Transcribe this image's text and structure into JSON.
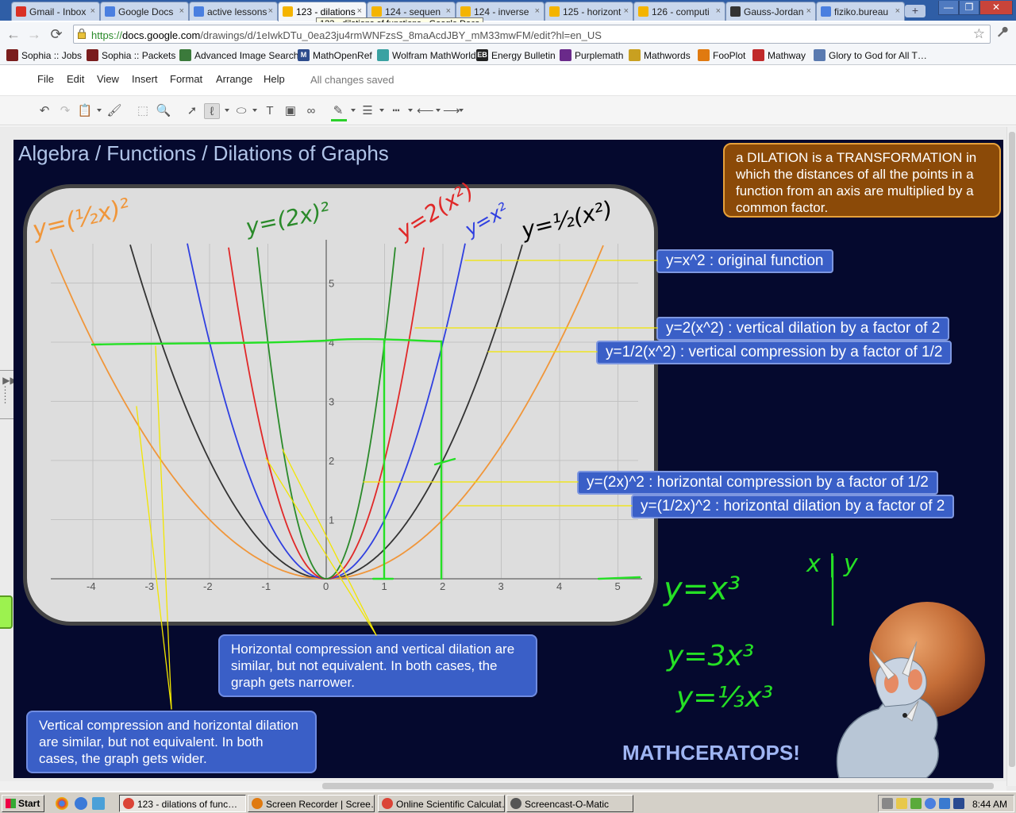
{
  "browser": {
    "tabs": [
      {
        "label": "Gmail - Inbox",
        "fav": "#d93025"
      },
      {
        "label": "Google Docs",
        "fav": "#4a7fe0"
      },
      {
        "label": "active lessons",
        "fav": "#4a7fe0"
      },
      {
        "label": "123 - dilations",
        "fav": "#f4b400",
        "active": true
      },
      {
        "label": "124 - sequen",
        "fav": "#f4b400"
      },
      {
        "label": "124 - inverse",
        "fav": "#f4b400"
      },
      {
        "label": "125 - horizont",
        "fav": "#f4b400"
      },
      {
        "label": "126 - computi",
        "fav": "#f4b400"
      },
      {
        "label": "Gauss-Jordan",
        "fav": "#333"
      },
      {
        "label": "fiziko.bureau",
        "fav": "#4a7fe0"
      }
    ],
    "tab_close": "×",
    "new_tab": "+",
    "window_controls": [
      "—",
      "❐",
      "✕"
    ],
    "tooltip": "123 - dilations of functions - Google Docs",
    "url": {
      "scheme": "https://",
      "host": "docs.google.com",
      "path": "/drawings/d/1eIwkDTu_0ea23ju4rmWNFzsS_8maAcdJBY_mM33mwFM/edit?hl=en_US"
    },
    "back": "←",
    "forward": "→",
    "reload": "⟳",
    "star": "☆",
    "wrench": "🔧",
    "bookmarks": [
      {
        "label": "Sophia :: Jobs",
        "fav": "#7a1d1d",
        "glyph": ""
      },
      {
        "label": "Sophia :: Packets",
        "fav": "#7a1d1d",
        "glyph": ""
      },
      {
        "label": "Advanced Image Search",
        "fav": "#3b7a3b",
        "glyph": ""
      },
      {
        "label": "MathOpenRef",
        "fav": "#2d4c8c",
        "glyph": "M"
      },
      {
        "label": "Wolfram MathWorld",
        "fav": "#3aa2a2",
        "glyph": ""
      },
      {
        "label": "Energy Bulletin",
        "fav": "#222",
        "glyph": "EB"
      },
      {
        "label": "Purplemath",
        "fav": "#6a2a8a",
        "glyph": ""
      },
      {
        "label": "Mathwords",
        "fav": "#c9a020",
        "glyph": ""
      },
      {
        "label": "FooPlot",
        "fav": "#e07a10",
        "glyph": ""
      },
      {
        "label": "Mathway",
        "fav": "#c02a2a",
        "glyph": ""
      },
      {
        "label": "Glory to God for All T…",
        "fav": "#5a7ab0",
        "glyph": ""
      }
    ]
  },
  "docs": {
    "menu": [
      "File",
      "Edit",
      "View",
      "Insert",
      "Format",
      "Arrange",
      "Help"
    ],
    "save_status": "All changes saved",
    "toolbar_icons": [
      "undo-icon",
      "redo-icon",
      "paste-icon",
      "paint-format-icon",
      "zoom-fit-icon",
      "zoom-icon",
      "select-icon",
      "line-tool-icon",
      "shape-icon",
      "textbox-icon",
      "image-icon",
      "link-icon",
      "line-color-icon",
      "line-weight-icon",
      "line-dash-icon",
      "line-start-icon",
      "line-end-icon"
    ]
  },
  "slide": {
    "title": "Algebra / Functions / Dilations of Graphs",
    "definition": "a DILATION is a TRANSFORMATION in which the distances of all the points in a function from an axis are multiplied by a common factor.",
    "callouts": [
      "y=x^2 : original function",
      "y=2(x^2) : vertical dilation by a factor of 2",
      "y=1/2(x^2) : vertical compression by a factor of 1/2",
      "y=(2x)^2 : horizontal compression by a factor of 1/2",
      "y=(1/2x)^2 : horizontal dilation by a factor of 2"
    ],
    "note_narrower": "Horizontal compression and vertical dilation are similar, but not equivalent. In both cases, the graph gets narrower.",
    "note_wider": "Vertical compression and horizontal dilation are similar, but not equivalent. In both cases, the graph gets wider.",
    "brand": "MATHCERATOPS!",
    "graph": {
      "x_ticks": [
        "-4",
        "-3",
        "-2",
        "-1",
        "0",
        "1",
        "2",
        "3",
        "4",
        "5"
      ],
      "y_ticks": [
        "1",
        "2",
        "3",
        "4",
        "5"
      ],
      "curve_colors": {
        "original": "#2f3fe0",
        "vertical_dilation": "#e02828",
        "vertical_compression": "#333333",
        "horizontal_compression": "#2a8a2a",
        "horizontal_dilation": "#f0963a"
      }
    },
    "handwriting": {
      "label_half_x": "y=(½x)²",
      "label_2x": "y=(2x)²",
      "label_2x2": "y=2(x²)",
      "label_x2": "y=x²",
      "label_halfx2": "y=½(x²)",
      "cubic_1": "y=x³",
      "cubic_2": "y=3x³",
      "cubic_3": "y=⅓x³",
      "table_head": "x | y"
    }
  },
  "taskbar": {
    "start": "Start",
    "tasks": [
      {
        "label": "123 - dilations of func…",
        "icon": "#db4437",
        "pressed": true
      },
      {
        "label": "Screen Recorder | Scree…",
        "icon": "#e07a10"
      },
      {
        "label": "Online Scientific Calculat…",
        "icon": "#db4437"
      },
      {
        "label": "Screencast-O-Matic",
        "icon": "#555"
      }
    ],
    "clock": "8:44 AM"
  }
}
